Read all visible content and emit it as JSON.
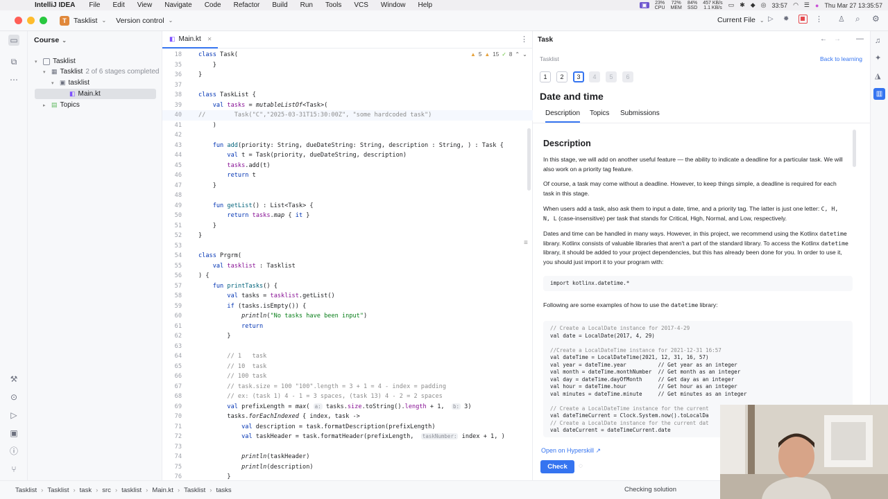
{
  "menubar": {
    "app_name": "IntelliJ IDEA",
    "menus": [
      "File",
      "Edit",
      "View",
      "Navigate",
      "Code",
      "Refactor",
      "Build",
      "Run",
      "Tools",
      "VCS",
      "Window",
      "Help"
    ],
    "stats": [
      {
        "top": "23%",
        "bottom": "CPU"
      },
      {
        "top": "72%",
        "bottom": "MEM"
      },
      {
        "top": "84%",
        "bottom": "SSD"
      }
    ],
    "net": {
      "up": "457 KB/s",
      "down": "1.1 KB/s"
    },
    "clock_small": "33:57",
    "datetime": "Thu Mar 27  13:35:57"
  },
  "titlebar": {
    "project_badge": "T",
    "project_name": "Tasklist",
    "vcs_label": "Version control",
    "run_config": "Current File"
  },
  "project_panel": {
    "title": "Course",
    "tree": [
      {
        "label": "Tasklist",
        "indent": 0
      },
      {
        "label": "Tasklist",
        "suffix": "2 of 6 stages completed",
        "indent": 1
      },
      {
        "label": "tasklist",
        "indent": 2
      },
      {
        "label": "Main.kt",
        "indent": 3,
        "selected": true
      },
      {
        "label": "Topics",
        "indent": 1
      }
    ]
  },
  "editor": {
    "tab_label": "Main.kt",
    "inspections": {
      "warnings": "5",
      "weak": "15",
      "typos": "8"
    },
    "lines": [
      {
        "n": "18",
        "html": "<span class='k'>class</span> Task("
      },
      {
        "n": "35",
        "html": "    }"
      },
      {
        "n": "36",
        "html": "}"
      },
      {
        "n": "37",
        "html": ""
      },
      {
        "n": "38",
        "html": "<span class='k'>class</span> TaskList {"
      },
      {
        "n": "39",
        "html": "    <span class='k'>val</span> <span class='pp'>tasks</span> = <span class='it'>mutableListOf</span>&lt;Task&gt;("
      },
      {
        "n": "40",
        "html": "<span class='c'>//        Task(\"C\",\"2025-03-31T15:30:00Z\", \"some hardcoded task\")</span>",
        "hl": true
      },
      {
        "n": "41",
        "html": "    )"
      },
      {
        "n": "42",
        "html": ""
      },
      {
        "n": "43",
        "html": "    <span class='k'>fun</span> <span class='fn'>add</span>(priority: String, dueDateString: String, description : String, ) : Task {"
      },
      {
        "n": "44",
        "html": "        <span class='k'>val</span> t = Task(priority, dueDateString, description)"
      },
      {
        "n": "45",
        "html": "        <span class='pp'>tasks</span>.add(t)"
      },
      {
        "n": "46",
        "html": "        <span class='k'>return</span> t"
      },
      {
        "n": "47",
        "html": "    }"
      },
      {
        "n": "48",
        "html": ""
      },
      {
        "n": "49",
        "html": "    <span class='k'>fun</span> <span class='fn'>getList</span>() : List&lt;Task&gt; {"
      },
      {
        "n": "50",
        "html": "        <span class='k'>return</span> <span class='pp'>tasks</span>.<span class='it'>map</span> { <span class='k'>it</span> }"
      },
      {
        "n": "51",
        "html": "    }"
      },
      {
        "n": "52",
        "html": "}"
      },
      {
        "n": "53",
        "html": ""
      },
      {
        "n": "54",
        "html": "<span class='k'>class</span> Prgrm("
      },
      {
        "n": "55",
        "html": "    <span class='k'>val</span> <span class='pp'>tasklist</span> : Tasklist"
      },
      {
        "n": "56",
        "html": ") {"
      },
      {
        "n": "57",
        "html": "    <span class='k'>fun</span> <span class='fn'>printTasks</span>() {"
      },
      {
        "n": "58",
        "html": "        <span class='k'>val</span> tasks = <span class='pp'>tasklist</span>.getList()"
      },
      {
        "n": "59",
        "html": "        <span class='k'>if</span> (tasks.isEmpty()) {"
      },
      {
        "n": "60",
        "html": "            <span class='it'>println</span>(<span class='s'>\"No tasks have been input\"</span>)"
      },
      {
        "n": "61",
        "html": "            <span class='k'>return</span>"
      },
      {
        "n": "62",
        "html": "        }"
      },
      {
        "n": "63",
        "html": ""
      },
      {
        "n": "64",
        "html": "        <span class='c'>// 1   task</span>"
      },
      {
        "n": "65",
        "html": "        <span class='c'>// 10  task</span>"
      },
      {
        "n": "66",
        "html": "        <span class='c'>// 100 task</span>"
      },
      {
        "n": "67",
        "html": "        <span class='c'>// task.size = 100 \"100\".length = 3 + 1 = 4 - index = padding</span>"
      },
      {
        "n": "68",
        "html": "        <span class='c'>// ex: (task 1) 4 - 1 = 3 spaces, (task 13) 4 - 2 = 2 spaces</span>"
      },
      {
        "n": "69",
        "html": "        <span class='k'>val</span> prefixLength = <span class='it'>max</span>( <span class='hint'>a:</span> tasks.<span class='pp'>size</span>.toString().<span class='pp'>length</span> + 1,  <span class='hint'>b:</span> 3)"
      },
      {
        "n": "70",
        "html": "        tasks.<span class='it'>forEachIndexed</span> { index, task -&gt;"
      },
      {
        "n": "71",
        "html": "            <span class='k'>val</span> description = task.formatDescription(prefixLength)"
      },
      {
        "n": "72",
        "html": "            <span class='k'>val</span> taskHeader = task.formatHeader(prefixLength,  <span class='hint'>taskNumber:</span> index + 1, )"
      },
      {
        "n": "73",
        "html": ""
      },
      {
        "n": "74",
        "html": "            <span class='it'>println</span>(taskHeader)"
      },
      {
        "n": "75",
        "html": "            <span class='it'>println</span>(description)"
      },
      {
        "n": "76",
        "html": "        }"
      }
    ]
  },
  "task_panel": {
    "title": "Task",
    "breadcrumb": "Tasklist",
    "back_link": "Back to learning",
    "stages": [
      {
        "label": "1",
        "state": "done"
      },
      {
        "label": "2",
        "state": "done"
      },
      {
        "label": "3",
        "state": "current"
      },
      {
        "label": "4",
        "state": "locked"
      },
      {
        "label": "5",
        "state": "locked"
      },
      {
        "label": "6",
        "state": "locked"
      }
    ],
    "heading": "Date and time",
    "tabs": [
      "Description",
      "Topics",
      "Submissions"
    ],
    "section_title": "Description",
    "para1": "In this stage, we will add on another useful feature — the ability to indicate a deadline for a particular task. We will also work on a priority tag feature.",
    "para2": "Of course, a task may come without a deadline. However, to keep things simple, a deadline is required for each task in this stage.",
    "para3a": "When users add a task, also ask them to input a date, time, and a priority tag. The latter is just one letter:",
    "para3_letters": "C, H, N, L",
    "para3b": "(case-insensitive) per task that stands for Critical, High, Normal, and Low, respectively.",
    "para4a": "Dates and time can be handled in many ways. However, in this project, we recommend using the Kotlinx",
    "para4_code1": "datetime",
    "para4b": "library. Kotlinx consists of valuable libraries that aren't a part of the standard library. To access the Kotlinx",
    "para4_code2": "datetime",
    "para4c": "library, it should be added to your project dependencies, but this has already been done for you. In order to use it, you should just import it to your program with:",
    "import_line": "import kotlinx.datetime.*",
    "para5a": "Following are some examples of how to use the",
    "para5_code": "datetime",
    "para5b": "library:",
    "example_lines": [
      "// Create a LocalDate instance for 2017-4-29",
      "val date = LocalDate(2017, 4, 29)",
      "",
      "//Create a LocalDateTime instance for 2021-12-31 16:57",
      "val dateTime = LocalDateTime(2021, 12, 31, 16, 57)",
      "val year = dateTime.year          // Get year as an integer",
      "val month = dateTime.monthNumber  // Get month as an integer",
      "val day = dateTime.dayOfMonth     // Get day as an integer",
      "val hour = dateTime.hour          // Get hour as an integer",
      "val minutes = dateTime.minute     // Get minutes as an integer",
      "",
      "// Create a LocalDateTime instance for the current",
      "val dateTimeCurrent = Clock.System.now().toLocalDa",
      "// Create a LocalDate instance for the current dat",
      "val dateCurrent = dateTimeCurrent.date"
    ],
    "hyperskill_link": "Open on Hyperskill ↗",
    "check_button": "Check"
  },
  "statusbar": {
    "crumbs": [
      "Tasklist",
      "Tasklist",
      "task",
      "src",
      "tasklist",
      "Main.kt",
      "Tasklist",
      "tasks"
    ],
    "status_text": "Checking solution"
  },
  "colors": {
    "accent": "#3574f0",
    "record": "#e5484d"
  }
}
